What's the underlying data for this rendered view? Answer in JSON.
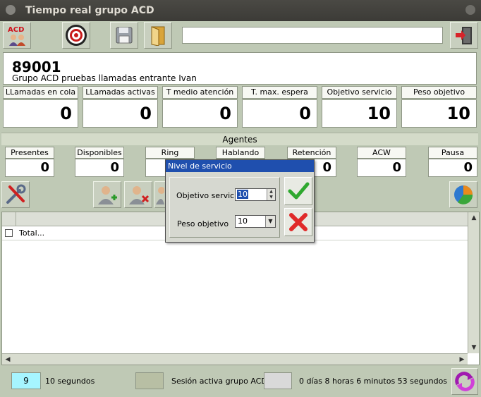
{
  "window": {
    "title": "Tiempo real grupo ACD"
  },
  "toolbar": {
    "acd_icon_text": "ACD",
    "search_value": "",
    "icons": [
      "acd-agent-icon",
      "target-icon",
      "save-icon",
      "door-open-icon",
      "exit-icon"
    ]
  },
  "group": {
    "number": "89001",
    "description": "Grupo ACD pruebas llamadas entrante Ivan"
  },
  "stats": [
    {
      "label": "LLamadas en cola",
      "value": "0"
    },
    {
      "label": "LLamadas activas",
      "value": "0"
    },
    {
      "label": "T medio atención",
      "value": "0"
    },
    {
      "label": "T. max. espera",
      "value": "0"
    },
    {
      "label": "Objetivo servicio",
      "value": "10"
    },
    {
      "label": "Peso objetivo",
      "value": "10"
    }
  ],
  "agents": {
    "title": "Agentes",
    "items": [
      {
        "label": "Presentes",
        "value": "0"
      },
      {
        "label": "Disponibles",
        "value": "0"
      },
      {
        "label": "Ring",
        "value": ""
      },
      {
        "label": "Hablando",
        "value": ""
      },
      {
        "label": "Retención",
        "value": "0"
      },
      {
        "label": "ACW",
        "value": "0"
      },
      {
        "label": "Pausa",
        "value": "0"
      }
    ]
  },
  "grid": {
    "rows": [
      {
        "label": "Total..."
      }
    ]
  },
  "status": {
    "refresh_value": "9",
    "refresh_label": "10 segundos",
    "session_label": "Sesión activa grupo ACD",
    "elapsed": "0 días 8 horas 6 minutos 53 segundos"
  },
  "dialog": {
    "title": "Nivel de servicio",
    "objective_label": "Objetivo servicio",
    "objective_value": "10",
    "weight_label": "Peso objetivo",
    "weight_value": "10"
  },
  "colors": {
    "window_bg": "#bfc9b5",
    "dialog_title": "#1f4fae",
    "refresh_box": "#a6f5ff",
    "session_box": "#b8bfa4",
    "elapsed_box": "#d9d9d9"
  }
}
